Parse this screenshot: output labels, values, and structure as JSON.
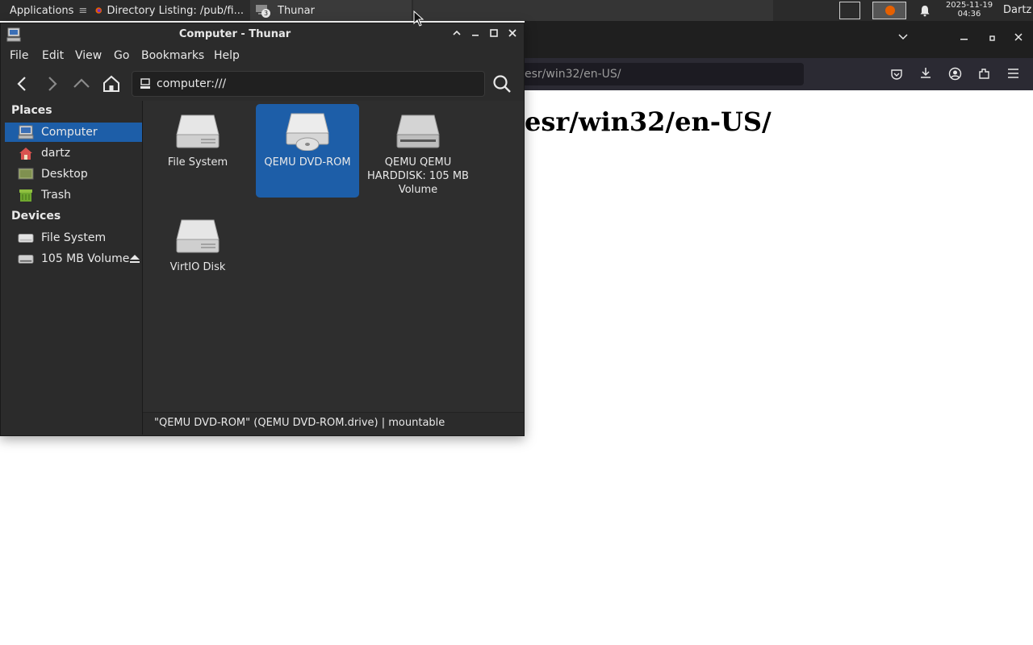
{
  "panel": {
    "applications_label": "Applications",
    "tasks": [
      {
        "label": "Directory Listing: /pub/fi..."
      },
      {
        "label": "Thunar"
      }
    ],
    "thunar_badge": "3",
    "clock_date": "2025-11-19",
    "clock_time": "04:36",
    "user": "Dartz"
  },
  "firefox": {
    "url_text": "esr/win32/en-US/",
    "heading": "esr/win32/en-US/"
  },
  "thunar": {
    "title": "Computer - Thunar",
    "menu": [
      "File",
      "Edit",
      "View",
      "Go",
      "Bookmarks",
      "Help"
    ],
    "location": "computer:///",
    "sidebar": {
      "places_header": "Places",
      "places": [
        {
          "label": "Computer",
          "icon": "computer-icon",
          "selected": true
        },
        {
          "label": "dartz",
          "icon": "home-icon"
        },
        {
          "label": "Desktop",
          "icon": "desktop-icon"
        },
        {
          "label": "Trash",
          "icon": "trash-icon"
        }
      ],
      "devices_header": "Devices",
      "devices": [
        {
          "label": "File System",
          "icon": "drive-icon"
        },
        {
          "label": "105 MB Volume",
          "icon": "drive-icon",
          "eject": true
        }
      ]
    },
    "items": [
      {
        "label": "File System",
        "icon": "harddisk-icon"
      },
      {
        "label": "QEMU DVD-ROM",
        "icon": "optical-drive-icon",
        "selected": true
      },
      {
        "label": "QEMU QEMU HARDDISK: 105 MB Volume",
        "icon": "harddisk-dark-icon"
      },
      {
        "label": "VirtIO Disk",
        "icon": "harddisk-icon"
      }
    ],
    "status": "\"QEMU DVD-ROM\" (QEMU DVD-ROM.drive)  |  mountable"
  },
  "colors": {
    "selection": "#1d5ea8",
    "window_bg": "#2b2b2b",
    "panel_bg": "#2b2b2b"
  }
}
